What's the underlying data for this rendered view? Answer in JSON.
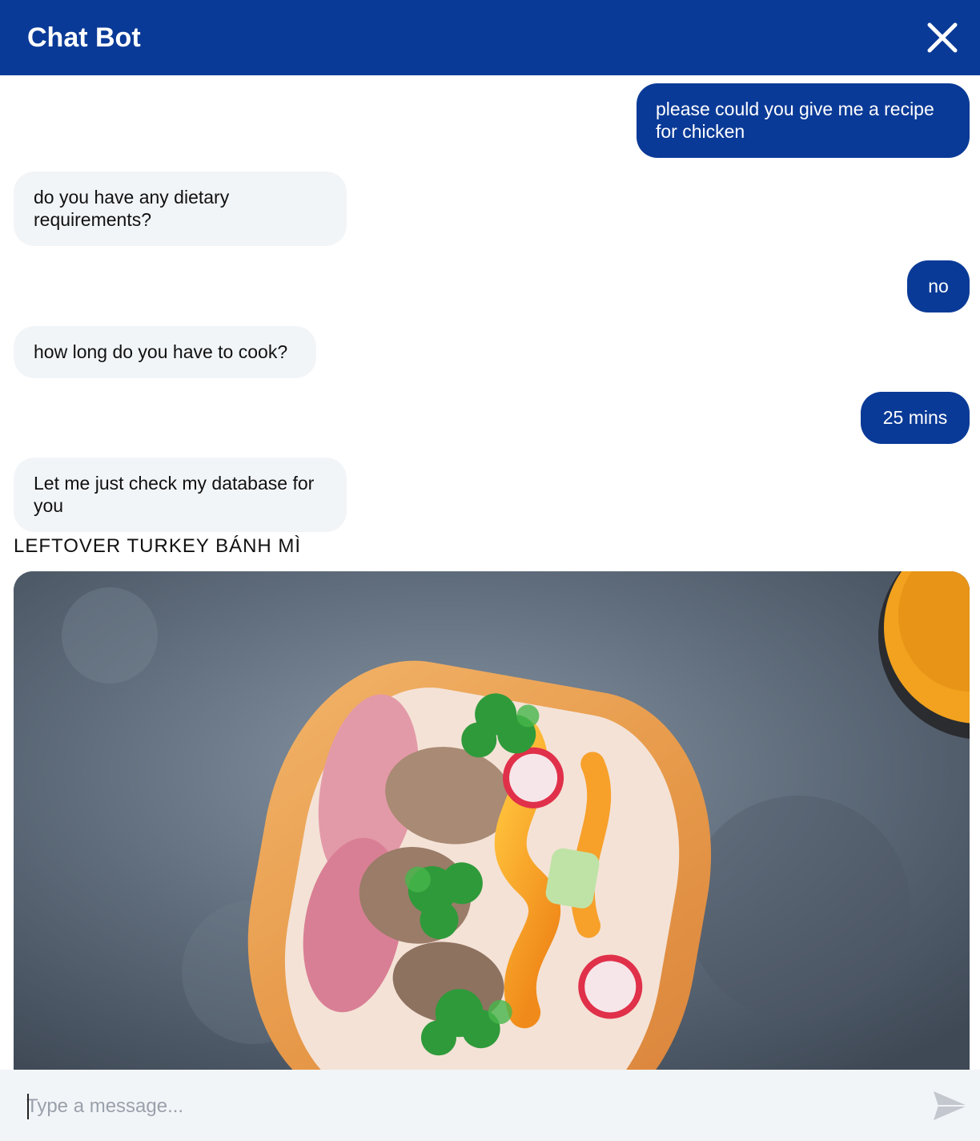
{
  "header": {
    "title": "Chat Bot",
    "close_icon": "close-icon"
  },
  "messages": [
    {
      "sender": "user",
      "text": "please could you give me a recipe for chicken"
    },
    {
      "sender": "bot",
      "text": "do you have any dietary requirements?"
    },
    {
      "sender": "user",
      "text": "no"
    },
    {
      "sender": "bot",
      "text": "how long do you have to cook?"
    },
    {
      "sender": "user",
      "text": "25 mins"
    },
    {
      "sender": "bot",
      "text": "Let me just check my database for you"
    }
  ],
  "recipe": {
    "title": "LEFTOVER TURKEY BÁNH MÌ",
    "image_subject": "banh mi sandwich photo"
  },
  "composer": {
    "placeholder": "Type a message...",
    "value": "",
    "send_icon": "send-icon"
  },
  "colors": {
    "brand": "#0a3a97",
    "bot_bubble": "#f2f5f8",
    "composer_bg": "#f2f5f8"
  }
}
